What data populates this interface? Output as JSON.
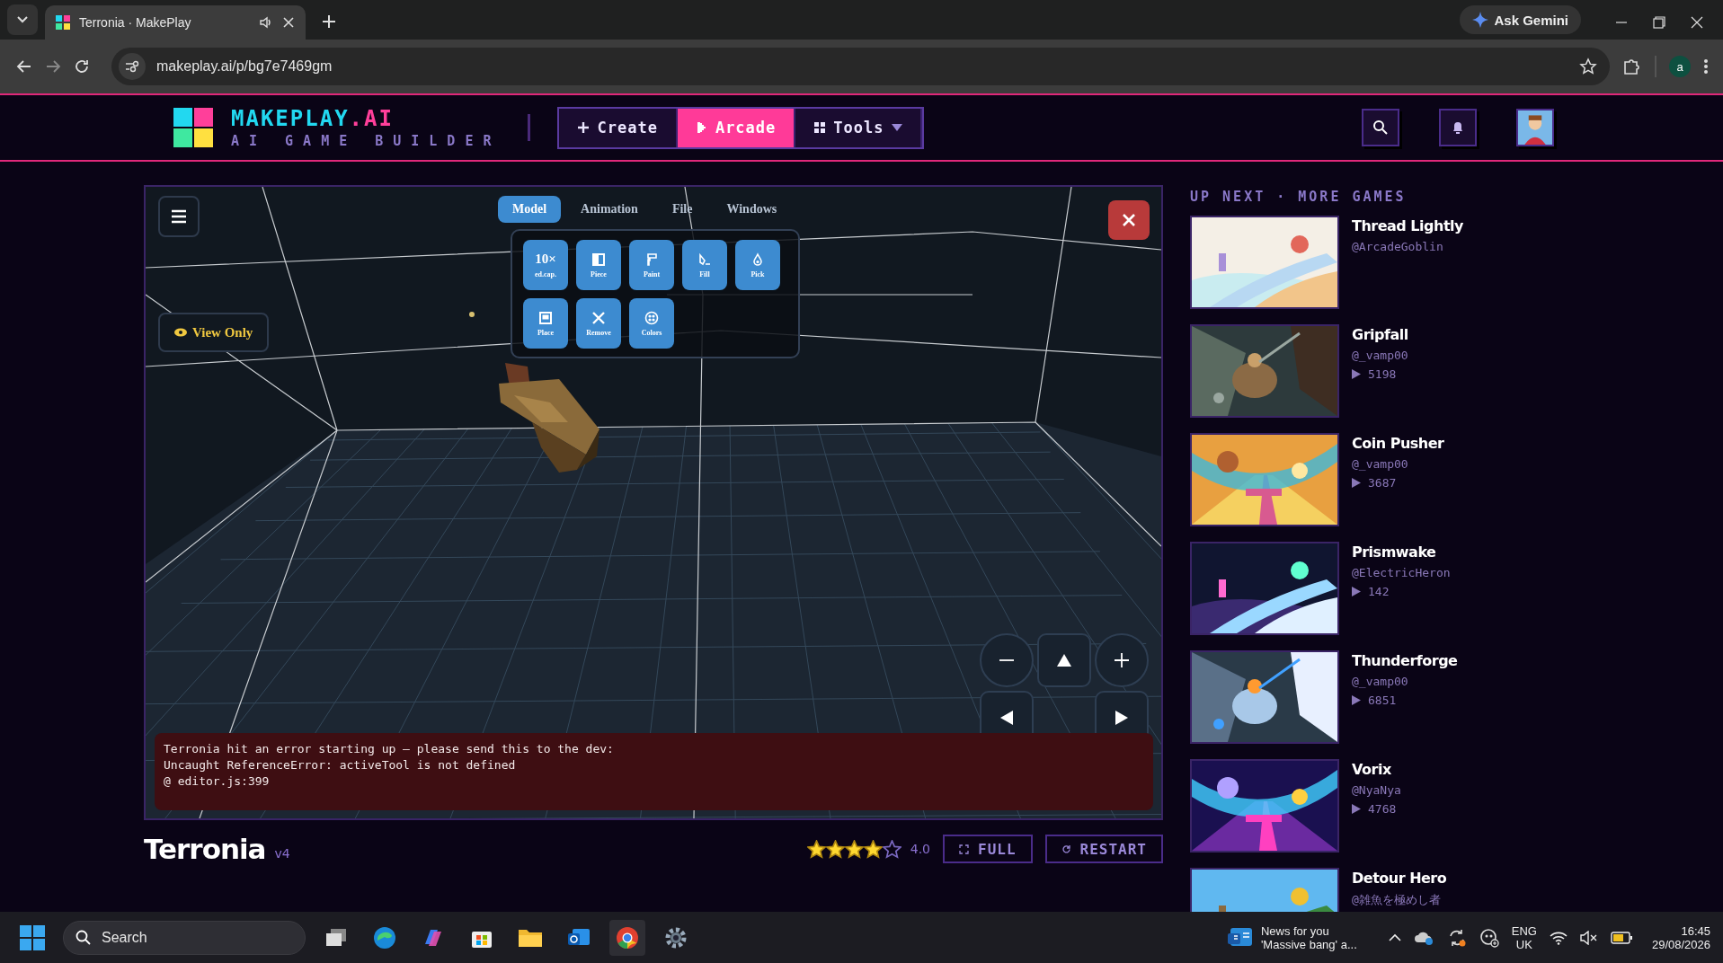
{
  "browser": {
    "tab": {
      "title": "Terronia · MakePlay"
    },
    "url": "makeplay.ai/p/bg7e7469gm",
    "gemini": "Ask Gemini",
    "profile": "a"
  },
  "header": {
    "brand": "MAKEPLAY",
    "brand_suffix": ".AI",
    "tagline": "AI GAME BUILDER",
    "nav": [
      {
        "label": "Create",
        "selected": false
      },
      {
        "label": "Arcade",
        "selected": true
      },
      {
        "label": "Tools",
        "selected": false
      }
    ]
  },
  "editor": {
    "tabs": [
      {
        "label": "Model",
        "selected": true
      },
      {
        "label": "Animation",
        "selected": false
      },
      {
        "label": "File",
        "selected": false
      },
      {
        "label": "Windows",
        "selected": false
      }
    ],
    "tools": [
      {
        "glyph": "10×",
        "label": "ed.cap."
      },
      {
        "label": "Piece"
      },
      {
        "label": "Paint"
      },
      {
        "label": "Fill"
      },
      {
        "label": "Pick"
      },
      {
        "label": "Place"
      },
      {
        "label": "Remove"
      },
      {
        "label": "Colors"
      }
    ],
    "view_mode": "View Only",
    "error": [
      "Terronia hit an error starting up — please send this to the dev:",
      "Uncaught ReferenceError: activeTool is not defined",
      "@ editor.js:399"
    ]
  },
  "game": {
    "title": "Terronia",
    "version": "v4",
    "stars": 4,
    "rating": "4.0",
    "buttons": [
      "FULL",
      "RESTART"
    ]
  },
  "sidebar": {
    "heading": "UP NEXT · MORE GAMES",
    "games": [
      {
        "title": "Thread Lightly",
        "author": "@ArcadeGoblin"
      },
      {
        "title": "Gripfall",
        "author": "@_vamp00",
        "plays": "5198"
      },
      {
        "title": "Coin Pusher",
        "author": "@_vamp00",
        "plays": "3687"
      },
      {
        "title": "Prismwake",
        "author": "@ElectricHeron",
        "plays": "142"
      },
      {
        "title": "Thunderforge",
        "author": "@_vamp00",
        "plays": "6851"
      },
      {
        "title": "Vorix",
        "author": "@NyaNya",
        "plays": "4768"
      },
      {
        "title": "Detour Hero",
        "author": "@雑魚を極めし者"
      }
    ]
  },
  "taskbar": {
    "search": {
      "placeholder": "Search"
    },
    "news": {
      "title": "News for you",
      "headline": "'Massive bang' a..."
    },
    "language": "ENG",
    "region": "UK",
    "time": "16:45",
    "date": "29/08/2026"
  }
}
